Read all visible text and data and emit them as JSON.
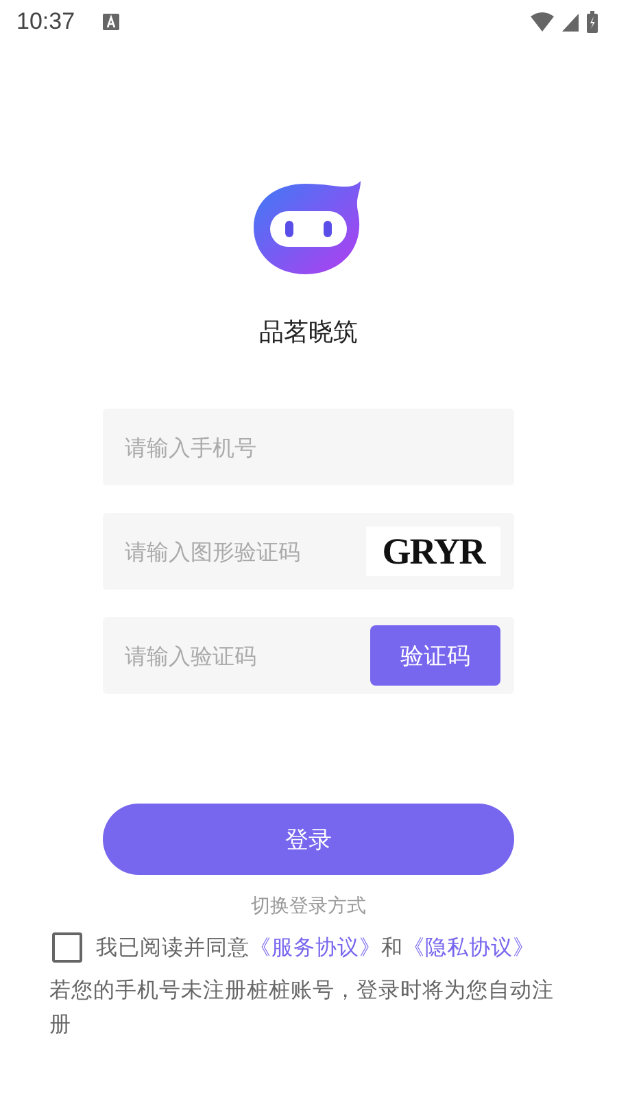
{
  "status_bar": {
    "time": "10:37"
  },
  "app": {
    "name": "品茗晓筑"
  },
  "form": {
    "phone": {
      "placeholder": "请输入手机号"
    },
    "captcha": {
      "placeholder": "请输入图形验证码",
      "image_text": "GRYR"
    },
    "code": {
      "placeholder": "请输入验证码",
      "button": "验证码"
    }
  },
  "login_button": "登录",
  "switch_link": "切换登录方式",
  "agreement": {
    "checked": false,
    "prefix": "我已阅读并同意",
    "service_link": "《服务协议》",
    "joiner": "和",
    "privacy_link": "《隐私协议》"
  },
  "notice": "若您的手机号未注册桩桩账号，登录时将为您自动注册"
}
